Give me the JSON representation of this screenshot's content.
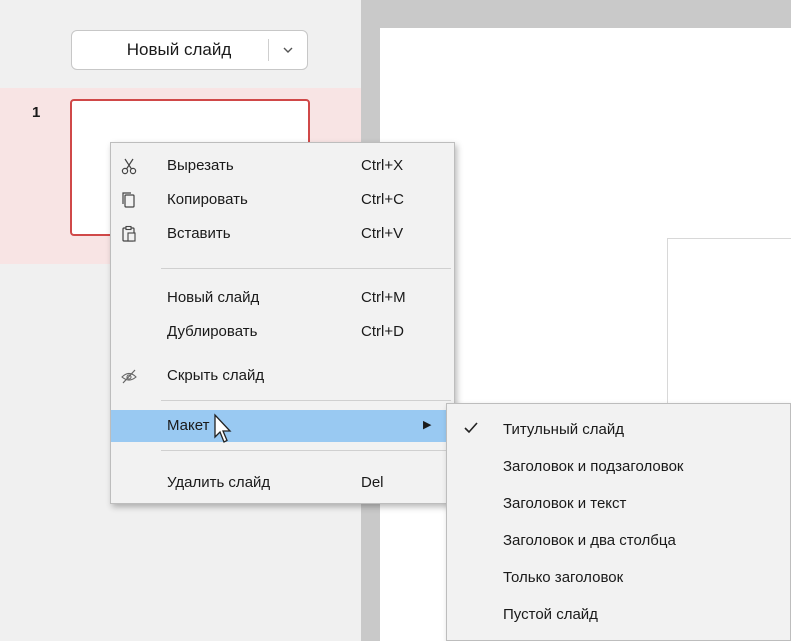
{
  "panel": {
    "new_slide_label": "Новый слайд",
    "slide_number": "1"
  },
  "context_menu": {
    "items": [
      {
        "label": "Вырезать",
        "shortcut": "Ctrl+X",
        "icon": "scissors-icon"
      },
      {
        "label": "Копировать",
        "shortcut": "Ctrl+C",
        "icon": "copy-icon"
      },
      {
        "label": "Вставить",
        "shortcut": "Ctrl+V",
        "icon": "paste-icon"
      },
      {
        "label": "Новый слайд",
        "shortcut": "Ctrl+M"
      },
      {
        "label": "Дублировать",
        "shortcut": "Ctrl+D"
      },
      {
        "label": "Скрыть слайд",
        "icon": "hide-eye-icon"
      },
      {
        "label": "Макет",
        "has_submenu": true,
        "highlighted": true
      },
      {
        "label": "Удалить слайд",
        "shortcut": "Del"
      }
    ]
  },
  "layout_submenu": {
    "items": [
      {
        "label": "Титульный слайд",
        "checked": true
      },
      {
        "label": "Заголовок и подзаголовок"
      },
      {
        "label": "Заголовок и текст"
      },
      {
        "label": "Заголовок и два столбца"
      },
      {
        "label": "Только заголовок"
      },
      {
        "label": "Пустой слайд"
      }
    ]
  },
  "colors": {
    "highlight": "#99c9f2",
    "selected_slide_border": "#d04848",
    "selected_slide_bg": "#f8e4e4"
  }
}
